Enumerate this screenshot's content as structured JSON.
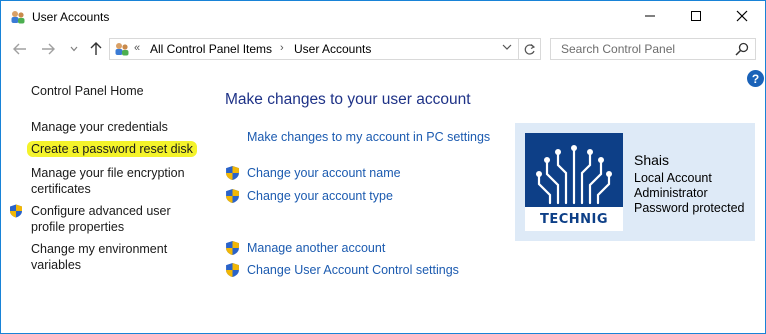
{
  "window": {
    "title": "User Accounts",
    "icon": "user-accounts-icon"
  },
  "address_bar": {
    "separator": "«",
    "crumbs": [
      "All Control Panel Items",
      "User Accounts"
    ],
    "arrow": "›"
  },
  "search": {
    "placeholder": "Search Control Panel"
  },
  "help": {
    "label": "?"
  },
  "left_pane": {
    "home": "Control Panel Home",
    "links": [
      "Manage your credentials",
      "Create a password reset disk",
      "Manage your file encryption certificates",
      "Configure advanced user profile properties",
      "Change my environment variables"
    ],
    "highlight_color": "#f4f32a"
  },
  "main": {
    "title": "Make changes to your user account",
    "links": [
      "Make changes to my account in PC settings",
      "Change your account name",
      "Change your account type",
      "Manage another account",
      "Change User Account Control settings"
    ]
  },
  "account": {
    "name": "Shais",
    "details": [
      "Local Account",
      "Administrator",
      "Password protected"
    ],
    "avatar_text": "TECHNIG"
  },
  "colors": {
    "link": "#1c5bb0",
    "title": "#1e3287",
    "card_bg": "#deeaf7",
    "avatar_bg": "#0d3f87",
    "window_border": "#1883d7"
  }
}
